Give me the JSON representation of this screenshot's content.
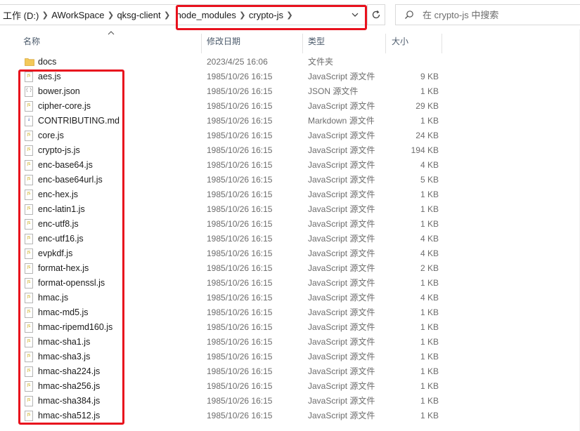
{
  "breadcrumb": {
    "items": [
      "工作 (D:)",
      "AWorkSpace",
      "qksg-client",
      "node_modules",
      "crypto-js"
    ]
  },
  "search": {
    "placeholder": "在 crypto-js 中搜索"
  },
  "columns": {
    "name": "名称",
    "date": "修改日期",
    "type": "类型",
    "size": "大小"
  },
  "files": [
    {
      "name": "docs",
      "date": "2023/4/25 16:06",
      "type": "文件夹",
      "size": "",
      "icon": "folder-icon"
    },
    {
      "name": "aes.js",
      "date": "1985/10/26 16:15",
      "type": "JavaScript 源文件",
      "size": "9 KB",
      "icon": "js-file-icon"
    },
    {
      "name": "bower.json",
      "date": "1985/10/26 16:15",
      "type": "JSON 源文件",
      "size": "1 KB",
      "icon": "json-file-icon"
    },
    {
      "name": "cipher-core.js",
      "date": "1985/10/26 16:15",
      "type": "JavaScript 源文件",
      "size": "29 KB",
      "icon": "js-file-icon"
    },
    {
      "name": "CONTRIBUTING.md",
      "date": "1985/10/26 16:15",
      "type": "Markdown 源文件",
      "size": "1 KB",
      "icon": "markdown-file-icon"
    },
    {
      "name": "core.js",
      "date": "1985/10/26 16:15",
      "type": "JavaScript 源文件",
      "size": "24 KB",
      "icon": "js-file-icon"
    },
    {
      "name": "crypto-js.js",
      "date": "1985/10/26 16:15",
      "type": "JavaScript 源文件",
      "size": "194 KB",
      "icon": "js-file-icon"
    },
    {
      "name": "enc-base64.js",
      "date": "1985/10/26 16:15",
      "type": "JavaScript 源文件",
      "size": "4 KB",
      "icon": "js-file-icon"
    },
    {
      "name": "enc-base64url.js",
      "date": "1985/10/26 16:15",
      "type": "JavaScript 源文件",
      "size": "5 KB",
      "icon": "js-file-icon"
    },
    {
      "name": "enc-hex.js",
      "date": "1985/10/26 16:15",
      "type": "JavaScript 源文件",
      "size": "1 KB",
      "icon": "js-file-icon"
    },
    {
      "name": "enc-latin1.js",
      "date": "1985/10/26 16:15",
      "type": "JavaScript 源文件",
      "size": "1 KB",
      "icon": "js-file-icon"
    },
    {
      "name": "enc-utf8.js",
      "date": "1985/10/26 16:15",
      "type": "JavaScript 源文件",
      "size": "1 KB",
      "icon": "js-file-icon"
    },
    {
      "name": "enc-utf16.js",
      "date": "1985/10/26 16:15",
      "type": "JavaScript 源文件",
      "size": "4 KB",
      "icon": "js-file-icon"
    },
    {
      "name": "evpkdf.js",
      "date": "1985/10/26 16:15",
      "type": "JavaScript 源文件",
      "size": "4 KB",
      "icon": "js-file-icon"
    },
    {
      "name": "format-hex.js",
      "date": "1985/10/26 16:15",
      "type": "JavaScript 源文件",
      "size": "2 KB",
      "icon": "js-file-icon"
    },
    {
      "name": "format-openssl.js",
      "date": "1985/10/26 16:15",
      "type": "JavaScript 源文件",
      "size": "1 KB",
      "icon": "js-file-icon"
    },
    {
      "name": "hmac.js",
      "date": "1985/10/26 16:15",
      "type": "JavaScript 源文件",
      "size": "4 KB",
      "icon": "js-file-icon"
    },
    {
      "name": "hmac-md5.js",
      "date": "1985/10/26 16:15",
      "type": "JavaScript 源文件",
      "size": "1 KB",
      "icon": "js-file-icon"
    },
    {
      "name": "hmac-ripemd160.js",
      "date": "1985/10/26 16:15",
      "type": "JavaScript 源文件",
      "size": "1 KB",
      "icon": "js-file-icon"
    },
    {
      "name": "hmac-sha1.js",
      "date": "1985/10/26 16:15",
      "type": "JavaScript 源文件",
      "size": "1 KB",
      "icon": "js-file-icon"
    },
    {
      "name": "hmac-sha3.js",
      "date": "1985/10/26 16:15",
      "type": "JavaScript 源文件",
      "size": "1 KB",
      "icon": "js-file-icon"
    },
    {
      "name": "hmac-sha224.js",
      "date": "1985/10/26 16:15",
      "type": "JavaScript 源文件",
      "size": "1 KB",
      "icon": "js-file-icon"
    },
    {
      "name": "hmac-sha256.js",
      "date": "1985/10/26 16:15",
      "type": "JavaScript 源文件",
      "size": "1 KB",
      "icon": "js-file-icon"
    },
    {
      "name": "hmac-sha384.js",
      "date": "1985/10/26 16:15",
      "type": "JavaScript 源文件",
      "size": "1 KB",
      "icon": "js-file-icon"
    },
    {
      "name": "hmac-sha512.js",
      "date": "1985/10/26 16:15",
      "type": "JavaScript 源文件",
      "size": "1 KB",
      "icon": "js-file-icon"
    }
  ],
  "colors": {
    "highlight": "#e8111d",
    "folder": "#f3c95a",
    "header_text": "#4b5a6b",
    "secondary_text": "#6d6d6d"
  }
}
